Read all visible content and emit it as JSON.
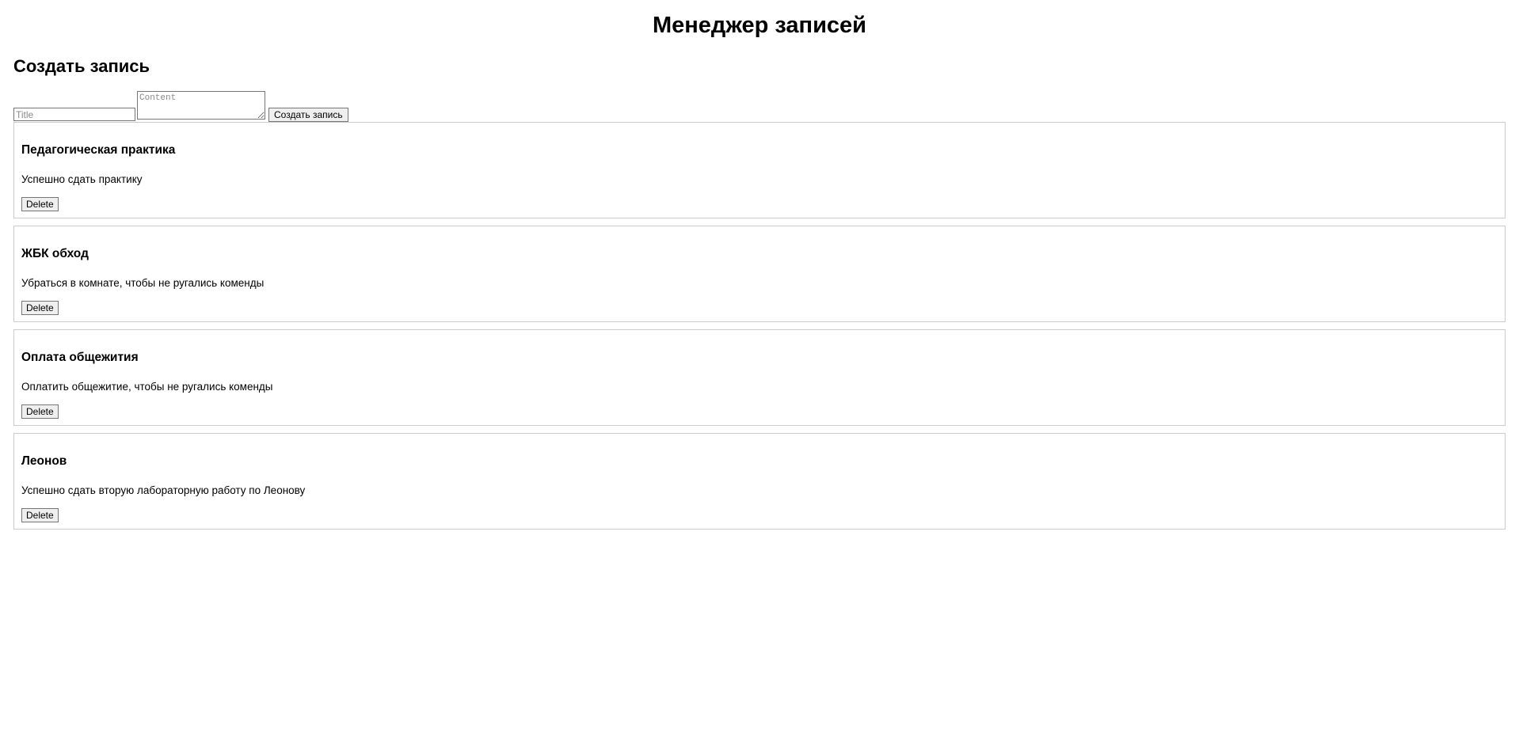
{
  "header": {
    "title": "Менеджер записей"
  },
  "form": {
    "heading": "Создать запись",
    "title_placeholder": "Title",
    "content_placeholder": "Content",
    "title_value": "",
    "content_value": "",
    "submit_label": "Создать запись"
  },
  "records": [
    {
      "title": "Педагогическая практика",
      "content": "Успешно сдать практику",
      "delete_label": "Delete"
    },
    {
      "title": "ЖБК обход",
      "content": "Убраться в комнате, чтобы не ругались коменды",
      "delete_label": "Delete"
    },
    {
      "title": "Оплата общежития",
      "content": "Оплатить общежитие, чтобы не ругались коменды",
      "delete_label": "Delete"
    },
    {
      "title": "Леонов",
      "content": "Успешно сдать вторую лабораторную работу по Леонову",
      "delete_label": "Delete"
    }
  ]
}
